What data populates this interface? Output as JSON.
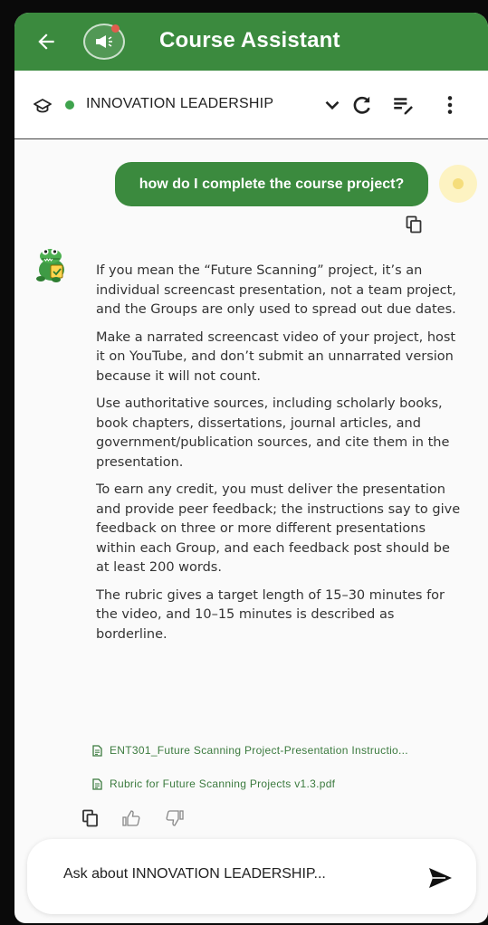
{
  "appbar": {
    "title": "Course Assistant"
  },
  "toolbar": {
    "course_name": "INNOVATION LEADERSHIP"
  },
  "conversation": {
    "user_message": "how do I complete the course project?",
    "assistant_paragraphs": [
      "If you mean the “Future Scanning” project, it’s an individual screencast presentation, not a team project, and the Groups are only used to spread out due dates.",
      "Make a narrated screencast video of your project, host it on YouTube, and don’t submit an unnarrated version because it will not count.",
      "Use authoritative sources, including scholarly books, book chapters, dissertations, journal articles, and government/publication sources, and cite them in the presentation.",
      "To earn any credit, you must deliver the presentation and provide peer feedback; the instructions say to give feedback on three or more different presentations within each Group, and each feedback post should be at least 200 words.",
      "The rubric gives a target length of 15–30 minutes for the video, and 10–15 minutes is described as borderline."
    ],
    "sources": [
      "ENT301_Future Scanning Project-Presentation Instructio...",
      "Rubric for Future Scanning Projects v1.3.pdf"
    ]
  },
  "composer": {
    "placeholder": "Ask about INNOVATION LEADERSHIP..."
  },
  "colors": {
    "brand_green": "#3b8a3e",
    "status_online": "#3fa34d",
    "link_green": "#3b7a3e"
  }
}
